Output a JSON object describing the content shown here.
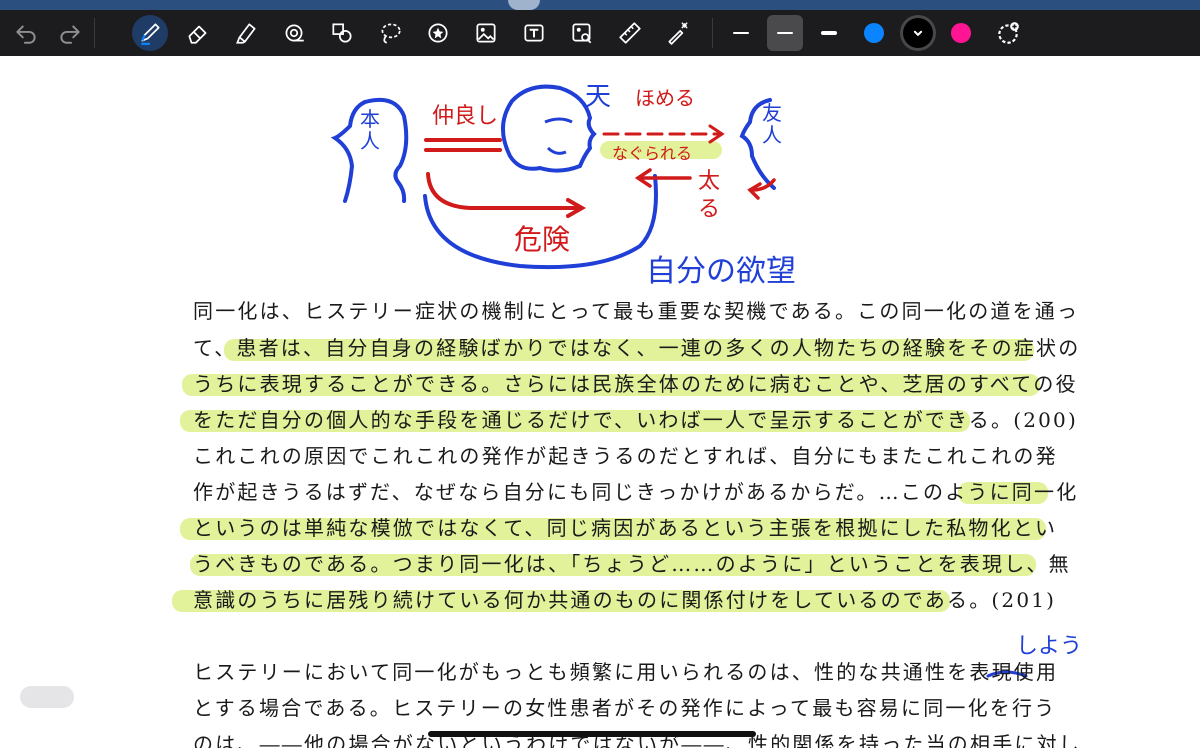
{
  "toolbar": {
    "tools": [
      "undo-icon",
      "redo-icon",
      "pen-icon",
      "eraser-icon",
      "highlighter-icon",
      "lasso-icon",
      "shapes-icon",
      "lasso-select-icon",
      "sticker-icon",
      "image-icon",
      "text-icon",
      "scan-icon",
      "ruler-icon",
      "laser-pointer-icon"
    ],
    "active_tool": "pen-icon",
    "stroke_widths": [
      "thin",
      "medium",
      "thick"
    ],
    "selected_stroke": "medium",
    "colors": {
      "blue": "#0a84ff",
      "black": "#000000",
      "pink": "#ff1493"
    },
    "selected_color": "black",
    "add_color_icon": "color-wheel-add-icon"
  },
  "annotations": {
    "honnin": "本人",
    "nakayoshi": "仲良し",
    "ten": "天",
    "homeru": "ほめる",
    "yujin": "友人",
    "nagurareru": "なぐられる",
    "futoru": "太る",
    "kiken": "危険",
    "jibun_no_yokubou": "自分の欲望",
    "shiyou": "しよう"
  },
  "body": {
    "lines": [
      "同一化は、ヒステリー症状の機制にとって最も重要な契機である。この同一化の道を通っ",
      "て、患者は、自分自身の経験ばかりではなく、一連の多くの人物たちの経験をその症状の",
      "うちに表現することができる。さらには民族全体のために病むことや、芝居のすべての役",
      "をただ自分の個人的な手段を通じるだけで、いわば一人で呈示することができる。(200)",
      "これこれの原因でこれこれの発作が起きうるのだとすれば、自分にもまたこれこれの発",
      "作が起きうるはずだ、なぜなら自分にも同じきっかけがあるからだ。…このように同一化",
      "というのは単純な模倣ではなくて、同じ病因があるという主張を根拠にした私物化とい",
      "うべきものである。つまり同一化は、「ちょうど……のように」ということを表現し、無",
      "意識のうちに居残り続けている何か共通のものに関係付けをしているのである。(201)",
      "ヒステリーにおいて同一化がもっとも頻繁に用いられるのは、性的な共通性を表現使用",
      "とする場合である。ヒステリーの女性患者がその発作によって最も容易に同一化を行う",
      "のは、――他の場合がないというわけではないが――、性的関係を持った当の相手に対し"
    ]
  }
}
